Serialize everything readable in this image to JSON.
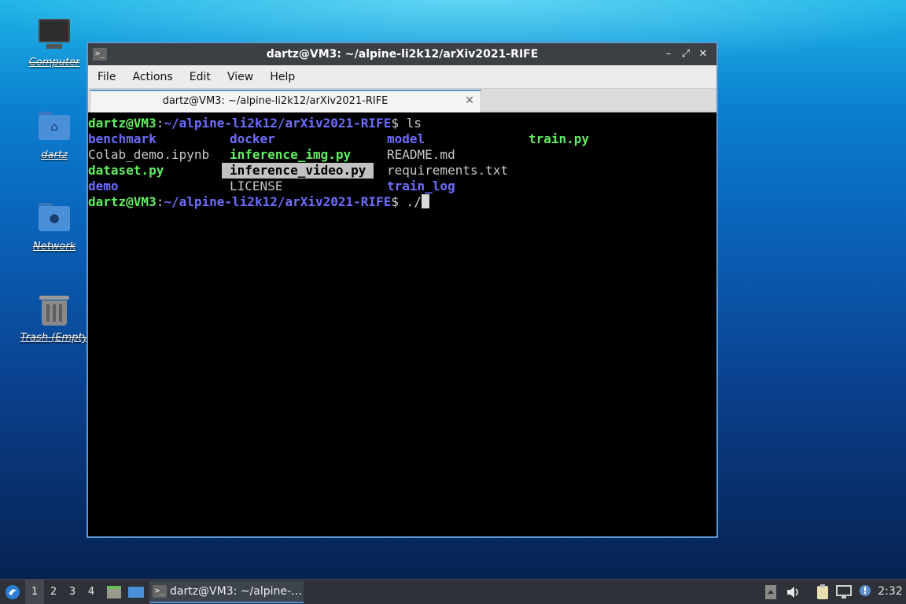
{
  "desktop": {
    "icons": [
      {
        "label": "Computer",
        "icon": "computer-icon"
      },
      {
        "label": "dartz",
        "icon": "home-folder-icon"
      },
      {
        "label": "Network",
        "icon": "network-folder-icon"
      },
      {
        "label": "Trash (Empty",
        "icon": "trash-icon"
      }
    ]
  },
  "window": {
    "title": "dartz@VM3: ~/alpine-li2k12/arXiv2021-RIFE",
    "controls": {
      "minimize": "–",
      "maximize": "⤢",
      "close": "✕"
    },
    "menu": [
      "File",
      "Actions",
      "Edit",
      "View",
      "Help"
    ],
    "tab": {
      "label": "dartz@VM3: ~/alpine-li2k12/arXiv2021-RIFE",
      "close": "✕"
    }
  },
  "terminal": {
    "prompt_user": "dartz@VM3",
    "prompt_sep": ":",
    "prompt_path": "~/alpine-li2k12/arXiv2021-RIFE",
    "prompt_dollar": "$",
    "command1": " ls",
    "command2": " ./",
    "listing": [
      [
        "benchmark",
        "docker",
        "model",
        "train.py"
      ],
      [
        "Colab_demo.ipynb",
        "inference_img.py",
        "README.md",
        ""
      ],
      [
        "dataset.py",
        "inference_video.py",
        "requirements.txt",
        ""
      ],
      [
        "demo",
        "LICENSE",
        "train_log",
        ""
      ]
    ],
    "colors": {
      "directory": "#6d6dff",
      "executable": "#5ff05f",
      "file": "#c9c9c9",
      "highlight_bg": "#c2c2c2"
    }
  },
  "taskbar": {
    "launcher_icon": "lxqt-menu-icon",
    "workspaces": [
      "1",
      "2",
      "3",
      "4"
    ],
    "active_workspace": "1",
    "quicklaunch": [
      "file-manager-icon",
      "show-desktop-icon"
    ],
    "task_label": "dartz@VM3: ~/alpine-…",
    "clock": "2:32"
  }
}
